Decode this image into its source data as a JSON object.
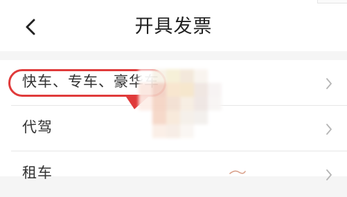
{
  "header": {
    "title": "开具发票",
    "back_icon": "chevron-left-icon"
  },
  "list": {
    "items": [
      {
        "label": "快车、专车、豪华车",
        "chevron_icon": "chevron-right-icon"
      },
      {
        "label": "代驾",
        "chevron_icon": "chevron-right-icon"
      },
      {
        "label": "租车",
        "chevron_icon": "chevron-right-icon"
      }
    ]
  },
  "annotation": {
    "highlight_color": "#e03a3a",
    "highlighted_item": "快车、专车、豪华车"
  },
  "colors": {
    "background": "#f5f5f5",
    "card": "#ffffff",
    "text": "#333333",
    "divider": "#e6e6e6"
  }
}
